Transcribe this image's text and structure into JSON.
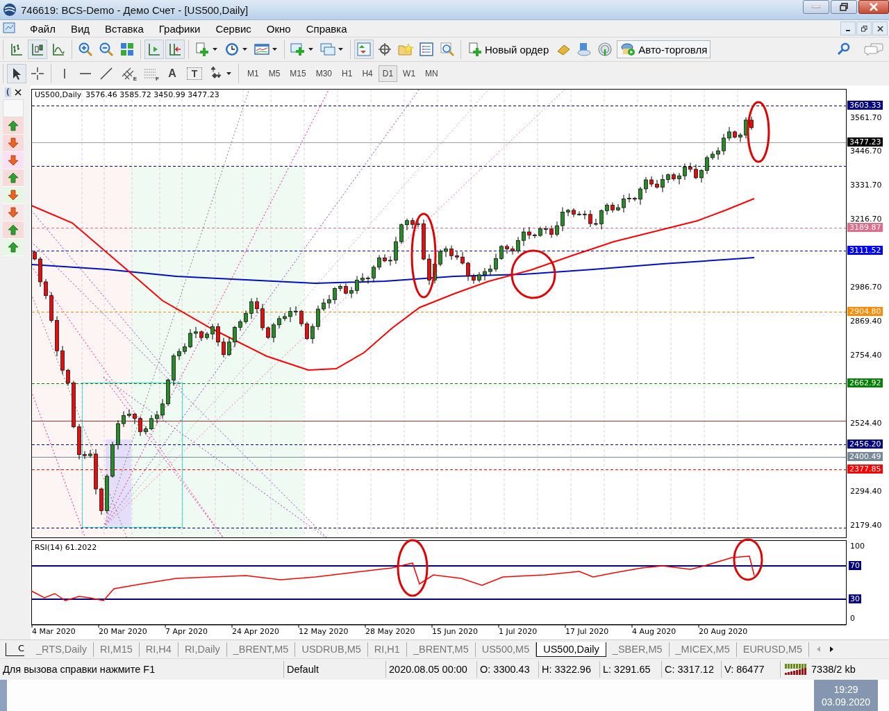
{
  "window": {
    "title": "746619: BCS-Demo - Демо Счет - [US500,Daily]"
  },
  "menu": [
    "Файл",
    "Вид",
    "Вставка",
    "Графики",
    "Сервис",
    "Окно",
    "Справка"
  ],
  "toolbar": {
    "new_order": "Новый ордер",
    "auto_trading": "Авто-торговля"
  },
  "drawing_tools": {
    "channel_letter": "E",
    "fibo_letter": "F",
    "text_tool": "A",
    "label_tool": "T"
  },
  "timeframes": [
    {
      "label": "M1",
      "selected": false
    },
    {
      "label": "M5",
      "selected": false
    },
    {
      "label": "M15",
      "selected": false
    },
    {
      "label": "M30",
      "selected": false
    },
    {
      "label": "H1",
      "selected": false
    },
    {
      "label": "H4",
      "selected": false
    },
    {
      "label": "D1",
      "selected": true
    },
    {
      "label": "W1",
      "selected": false
    },
    {
      "label": "MN",
      "selected": false
    }
  ],
  "signals_panel": {
    "header": "(",
    "items": [
      {
        "kind": "up",
        "color": "#f8dada"
      },
      {
        "kind": "down",
        "color": "#f8dada"
      },
      {
        "kind": "down",
        "color": "#fbe0f4"
      },
      {
        "kind": "up",
        "color": "#f8dada"
      },
      {
        "kind": "down",
        "color": "#e6f7e6"
      },
      {
        "kind": "down",
        "color": "#f8e6e6"
      },
      {
        "kind": "up",
        "color": "#f8dada"
      },
      {
        "kind": "up",
        "color": "#e6f7e6"
      }
    ],
    "footer": "C"
  },
  "chart": {
    "symbol": "US500,Daily",
    "ohlc": "3576.46 3585.72 3450.99 3477.23",
    "price_ticks": [
      "3561.70",
      "3446.70",
      "3331.70",
      "3216.70",
      "2986.70",
      "2869.40",
      "2754.40",
      "2524.40",
      "2294.40",
      "2179.40"
    ],
    "price_lines": [
      {
        "label": "3603.33",
        "color": "#000080"
      },
      {
        "label": "3477.23",
        "color": "#000000"
      },
      {
        "label": "3189.87",
        "color": "#dc6e8c"
      },
      {
        "label": "3111.52",
        "color": "#0000ff"
      },
      {
        "label": "2904.80",
        "color": "#ff8c00"
      },
      {
        "label": "2662.92",
        "color": "#008000"
      },
      {
        "label": "2456.20",
        "color": "#000080"
      },
      {
        "label": "2400.49",
        "color": "#778899"
      },
      {
        "label": "2377.85",
        "color": "#ff0000"
      }
    ],
    "dates": [
      "4 Mar 2020",
      "20 Mar 2020",
      "7 Apr 2020",
      "24 Apr 2020",
      "12 May 2020",
      "28 May 2020",
      "15 Jun 2020",
      "1 Jul 2020",
      "17 Jul 2020",
      "4 Aug 2020",
      "20 Aug 2020"
    ],
    "rsi": {
      "title": "RSI(14) 61.2022",
      "ticks": [
        {
          "label": "100",
          "kind": "plain"
        },
        {
          "label": "70",
          "kind": "level"
        },
        {
          "label": "30",
          "kind": "level"
        },
        {
          "label": "0",
          "kind": "plain"
        }
      ]
    }
  },
  "tabs": [
    {
      "label": "_RTS,Daily",
      "selected": false
    },
    {
      "label": "RI,M15",
      "selected": false
    },
    {
      "label": "RI,H4",
      "selected": false
    },
    {
      "label": "RI,Daily",
      "selected": false
    },
    {
      "label": "_BRENT,M5",
      "selected": false
    },
    {
      "label": "USDRUB,M5",
      "selected": false
    },
    {
      "label": "RI,H1",
      "selected": false
    },
    {
      "label": "_BRENT,M5",
      "selected": false
    },
    {
      "label": "US500,M5",
      "selected": false
    },
    {
      "label": "US500,Daily",
      "selected": true
    },
    {
      "label": "_SBER,M5",
      "selected": false
    },
    {
      "label": "_MICEX,M5",
      "selected": false
    },
    {
      "label": "EURUSD,M5",
      "selected": false
    }
  ],
  "status_bar": {
    "help": "Для вызова справки нажмите F1",
    "profile": "Default",
    "time": "2020.08.05 00:00",
    "open": "O: 3300.43",
    "high": "H: 3322.96",
    "low": "L: 3291.65",
    "close": "C: 3317.12",
    "volume": "V: 86477",
    "traffic": "7338/2 kb"
  },
  "taskbar": {
    "time": "19:29",
    "date": "03.09.2020"
  }
}
